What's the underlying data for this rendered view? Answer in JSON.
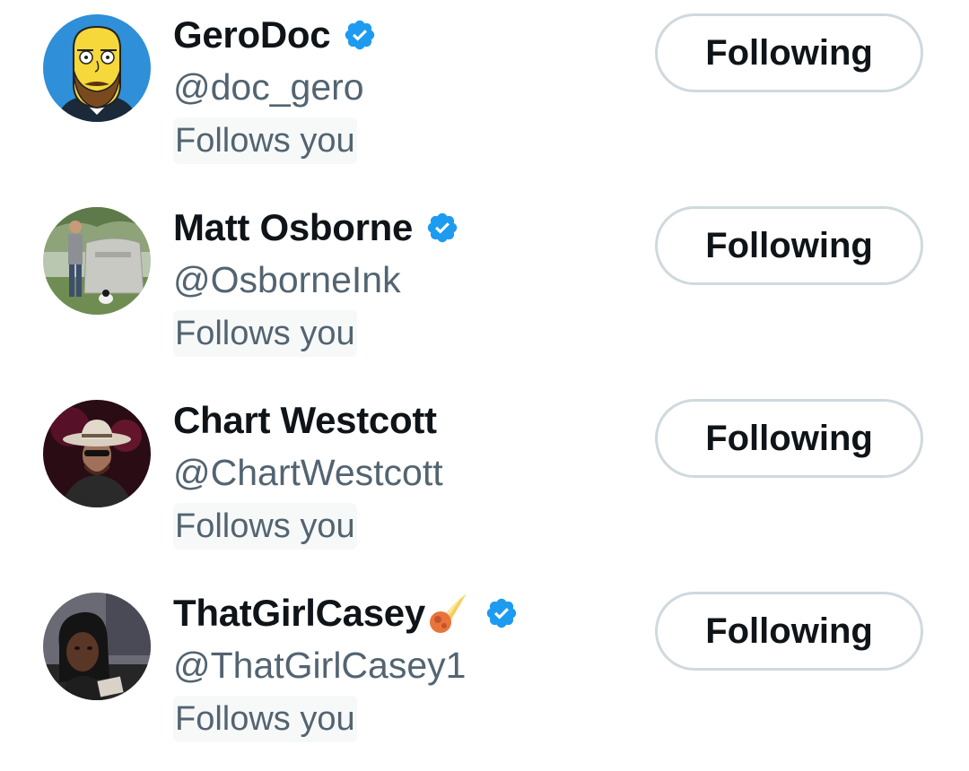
{
  "users": [
    {
      "name": "GeroDoc",
      "handle": "@doc_gero",
      "follows_you": "Follows you",
      "button_label": "Following",
      "verified": true,
      "avatar_icon": "cartoon-bearded-man-avatar"
    },
    {
      "name": "Matt Osborne",
      "handle": "@OsborneInk",
      "follows_you": "Follows you",
      "button_label": "Following",
      "verified": true,
      "avatar_icon": "man-by-gravestone-photo-avatar"
    },
    {
      "name": "Chart Westcott",
      "handle": "@ChartWestcott",
      "follows_you": "Follows you",
      "button_label": "Following",
      "verified": false,
      "avatar_icon": "cowboy-hat-man-photo-avatar"
    },
    {
      "name": "ThatGirlCasey",
      "name_emoji": "comet-emoji",
      "handle": "@ThatGirlCasey1",
      "follows_you": "Follows you",
      "button_label": "Following",
      "verified": true,
      "avatar_icon": "woman-selfie-photo-avatar"
    }
  ],
  "colors": {
    "verified_blue": "#1d9bf0",
    "name_text": "#0f1419",
    "secondary_text": "#536471",
    "button_border": "#cfd9de",
    "follows_you_bg": "#f7f9f9"
  }
}
